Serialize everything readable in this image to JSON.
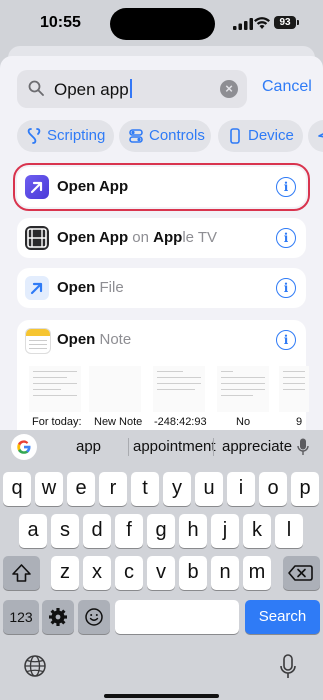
{
  "status": {
    "time": "10:55",
    "battery": "93"
  },
  "search": {
    "query": "Open app",
    "clear_glyph": "×",
    "cancel_label": "Cancel"
  },
  "chips": [
    {
      "label": "Scripting",
      "icon": "scripting-icon"
    },
    {
      "label": "Controls",
      "icon": "controls-icon"
    },
    {
      "label": "Device",
      "icon": "device-icon"
    }
  ],
  "results": [
    {
      "bold": "Open App",
      "dim": "",
      "icon": "arrow-up-right-icon",
      "selected": true
    },
    {
      "bold1": "Open App",
      "dim1": " on ",
      "bold2": "App",
      "dim2": "le TV",
      "icon": "film-icon"
    },
    {
      "bold": "Open",
      "dim": " File",
      "icon": "arrow-up-right-icon"
    },
    {
      "bold": "Open",
      "dim": " Note",
      "icon": "notes-icon"
    }
  ],
  "note_thumbs": [
    "For today:",
    "New Note",
    "-248:42:93",
    "No",
    "9"
  ],
  "info_glyph": "i",
  "suggestions": [
    "app",
    "appointment",
    "appreciate"
  ],
  "keys": {
    "row1": [
      "q",
      "w",
      "e",
      "r",
      "t",
      "y",
      "u",
      "i",
      "o",
      "p"
    ],
    "row2": [
      "a",
      "s",
      "d",
      "f",
      "g",
      "h",
      "j",
      "k",
      "l"
    ],
    "row3": [
      "z",
      "x",
      "c",
      "v",
      "b",
      "n",
      "m"
    ],
    "numbers": "123",
    "search": "Search"
  }
}
